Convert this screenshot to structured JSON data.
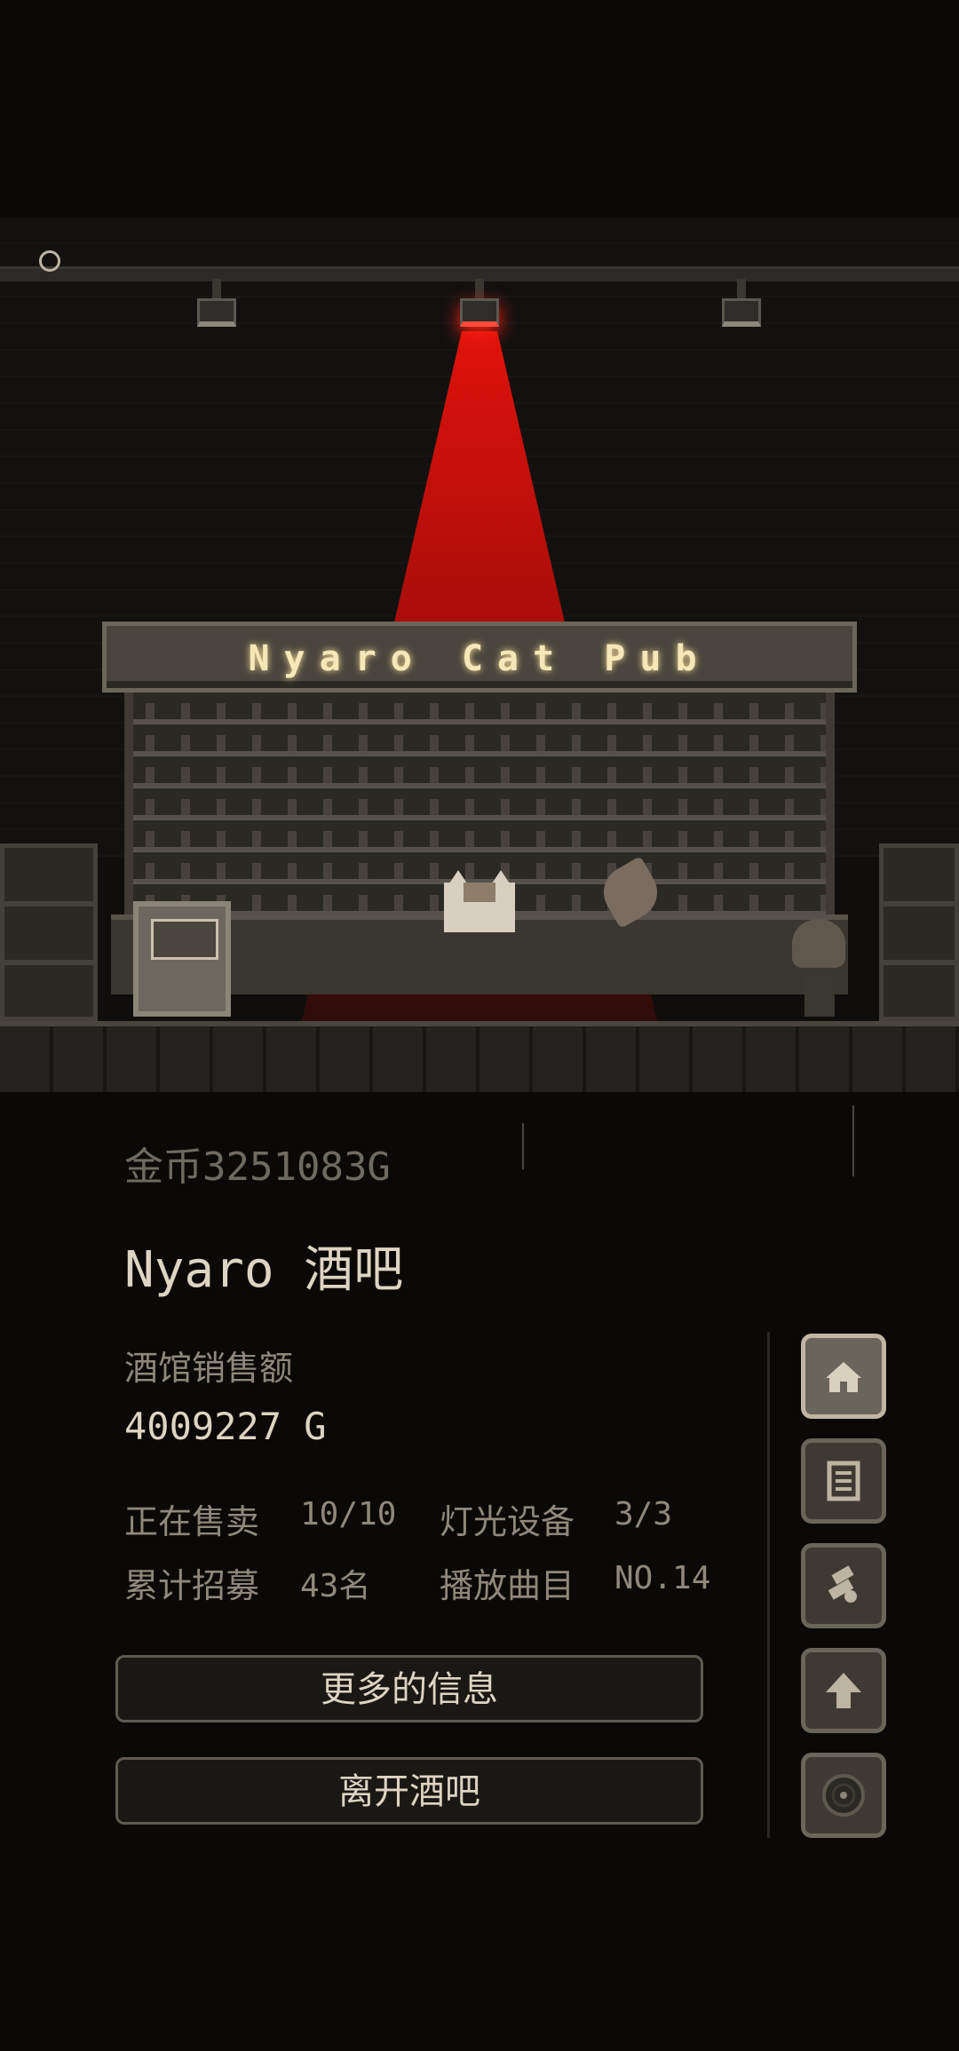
{
  "scene": {
    "sign_text": "Nyaro Cat Pub",
    "beam_color": "#e0120c"
  },
  "panel": {
    "coins": "金币3251083G",
    "pub_name": "Nyaro 酒吧",
    "sales_label": "酒馆销售额",
    "sales_value": "4009227 G",
    "stats": {
      "selling_label": "正在售卖",
      "selling_value": "10/10",
      "lighting_label": "灯光设备",
      "lighting_value": "3/3",
      "recruit_label": "累计招募",
      "recruit_value": "43名",
      "music_label": "播放曲目",
      "music_value": "NO.14"
    },
    "buttons": {
      "more_info": "更多的信息",
      "leave": "离开酒吧"
    }
  },
  "side_menu": [
    {
      "icon": "pub-icon",
      "active": true
    },
    {
      "icon": "menu-list-icon",
      "active": false
    },
    {
      "icon": "recruit-icon",
      "active": false
    },
    {
      "icon": "upgrade-arrow-icon",
      "active": false
    },
    {
      "icon": "record-disc-icon",
      "active": false
    }
  ]
}
